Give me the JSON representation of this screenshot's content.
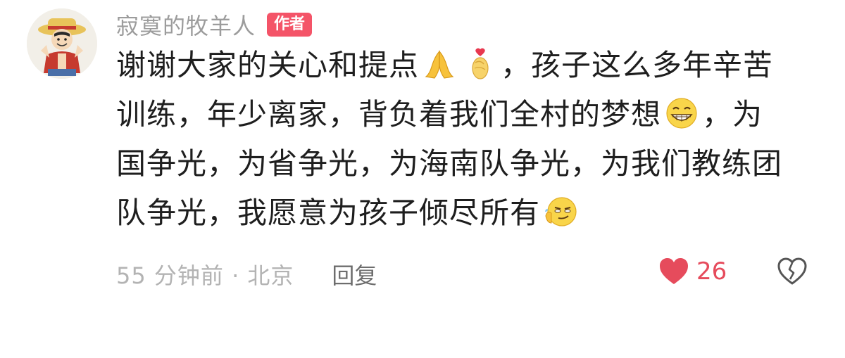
{
  "comment": {
    "author_name": "寂寞的牧羊人",
    "author_badge": "作者",
    "lines": [
      {
        "parts": [
          "谢谢大家的关心和提点",
          "，孩子这么多年辛苦"
        ]
      },
      {
        "parts": [
          "训练，年少离家，背负着我们全村的梦想",
          "，为"
        ]
      },
      {
        "parts": [
          "国争光，为省争光，为海南队争光，为我们教练团"
        ]
      },
      {
        "parts": [
          "队争光，我愿意为孩子倾尽所有"
        ]
      }
    ],
    "emojis": [
      "pray-emoji",
      "finger-heart-emoji",
      "grin-emoji",
      "smirk-emoji"
    ],
    "time_location": "55 分钟前 · 北京",
    "reply_label": "回复",
    "like_count": "26",
    "colors": {
      "accent": "#f45468",
      "like": "#e64b5c",
      "text": "#1e1e1e",
      "meta": "#b3b3b3"
    }
  }
}
